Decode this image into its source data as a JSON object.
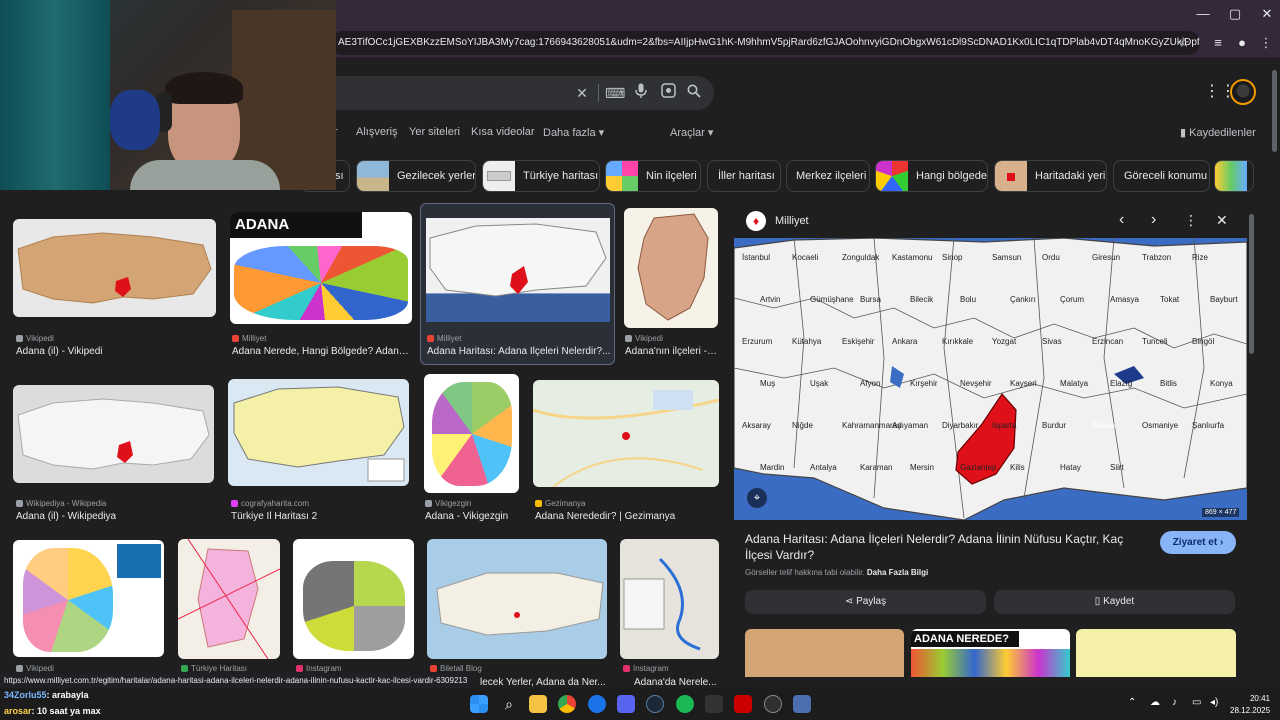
{
  "browser": {
    "url": "AE3TifOCc1jGEXBKzzEMSoYIJBA3My7cag:1766943628051&udm=2&fbs=AIIjpHwG1hK-M9hhmV5pjRard6zfGJAOohnvyiGDnObgxW61cDl9ScDNAD1Kx0LIC1qTDPlab4vDT4qMnoKGyZUkiDpf4w28qDl2lL...",
    "window_controls": [
      "—",
      "▢",
      "✕"
    ]
  },
  "nav_tabs": [
    "r",
    "Alışveriş",
    "Yer siteleri",
    "Kısa videolar",
    "Daha fazla ▾",
    "Araçlar ▾"
  ],
  "saved_label": "Kaydedilenler",
  "chips": [
    "sı",
    "Gezilecek yerler",
    "Türkiye haritası",
    "Nin ilçeleri",
    "İller haritası",
    "Merkez ilçeleri",
    "Hangi bölgede",
    "Haritadaki yeri",
    "Göreceli konumu"
  ],
  "results": [
    {
      "source": "Vikipedi",
      "title": "Adana (il) - Vikipedi",
      "fav": "#9aa0a6"
    },
    {
      "source": "Milliyet",
      "title": "Adana Nerede, Hangi Bölgede? Adana'...",
      "fav": "#ea4335"
    },
    {
      "source": "Milliyet",
      "title": "Adana Haritası: Adana İlçeleri Nelerdir?...",
      "fav": "#ea4335"
    },
    {
      "source": "Vikipedi",
      "title": "Adana'nın ilçeleri - ...",
      "fav": "#9aa0a6"
    },
    {
      "source": "Wikipediya - Wikipedia",
      "title": "Adana (il) - Wikipediya",
      "fav": "#9aa0a6"
    },
    {
      "source": "cografyaharita.com",
      "title": "Türkiye İl Haritası 2",
      "fav": "#e040fb"
    },
    {
      "source": "Vikigezgin",
      "title": "Adana - Vikigezgin",
      "fav": "#9aa0a6"
    },
    {
      "source": "Gezimanya",
      "title": "Adana Neredediг? | Gezimanya",
      "fav": "#fbbc04"
    },
    {
      "source": "Vikipedi",
      "title": "",
      "fav": "#9aa0a6"
    },
    {
      "source": "Türkiye Haritası",
      "title": "",
      "fav": "#34a853"
    },
    {
      "source": "Instagram",
      "title": "",
      "fav": "#e1306c"
    },
    {
      "source": "Biletall Blog",
      "title": "lecek Yerler, Adana da Ner...",
      "fav": "#ea4335"
    },
    {
      "source": "Instagram",
      "title": "Adana'da Nerele...",
      "fav": "#e1306c"
    }
  ],
  "thumb_labels": {
    "adana_nerede": "ADANA NEREDE?"
  },
  "panel": {
    "source": "Milliyet",
    "dimensions": "869 × 477",
    "title": "Adana Haritası: Adana İlçeleri Nelerdir? Adana İlinin Nüfusu Kaçtır, Kaç İlçesi Vardır?",
    "visit_label": "Ziyaret et",
    "copyright": "Görseller telif hakkına tabi olabilir.",
    "more_info": "Daha Fazla Bilgi",
    "share_label": "Paylaş",
    "save_label": "Kaydet",
    "map_cities": [
      "İstanbul",
      "Kocaeli",
      "Zonguldak",
      "Kastamonu",
      "Sinop",
      "Samsun",
      "Ordu",
      "Giresun",
      "Trabzon",
      "Rize",
      "Artvin",
      "Gümüşhane",
      "Bursa",
      "Bilecik",
      "Bolu",
      "Çankırı",
      "Çorum",
      "Amasya",
      "Tokat",
      "Bayburt",
      "Erzurum",
      "Kütahya",
      "Eskişehir",
      "Ankara",
      "Kırıkkale",
      "Yozgat",
      "Sivas",
      "Erzincan",
      "Tunceli",
      "Bingöl",
      "Muş",
      "Uşak",
      "Afyon",
      "Kırşehir",
      "Nevşehir",
      "Kayseri",
      "Malatya",
      "Elazığ",
      "Bitlis",
      "Konya",
      "Aksaray",
      "Niğde",
      "Kahramanmaraş",
      "Adıyaman",
      "Diyarbakır",
      "Isparta",
      "Burdur",
      "Adana",
      "Osmaniye",
      "Şanlıurfa",
      "Mardin",
      "Antalya",
      "Karaman",
      "Mersin",
      "Gaziantep",
      "Kilis",
      "Hatay",
      "Siirt"
    ]
  },
  "status_url": "https://www.milliyet.com.tr/egitim/haritalar/adana-haritasi-adana-ilceleri-nelerdir-adana-ilinin-nufusu-kactir-kac-ilcesi-vardir-6309213",
  "chat": [
    {
      "user": "34Zorlu55",
      "message": ": arabayla"
    },
    {
      "user": "arosar",
      "message": ": 10 saat ya max"
    }
  ],
  "clock": {
    "time": "20:41",
    "date": "28.12.2025"
  },
  "colors": {
    "accent": "#8ab4f8",
    "visit_bg": "#8ab4f8",
    "adana_red": "#e0101a"
  }
}
